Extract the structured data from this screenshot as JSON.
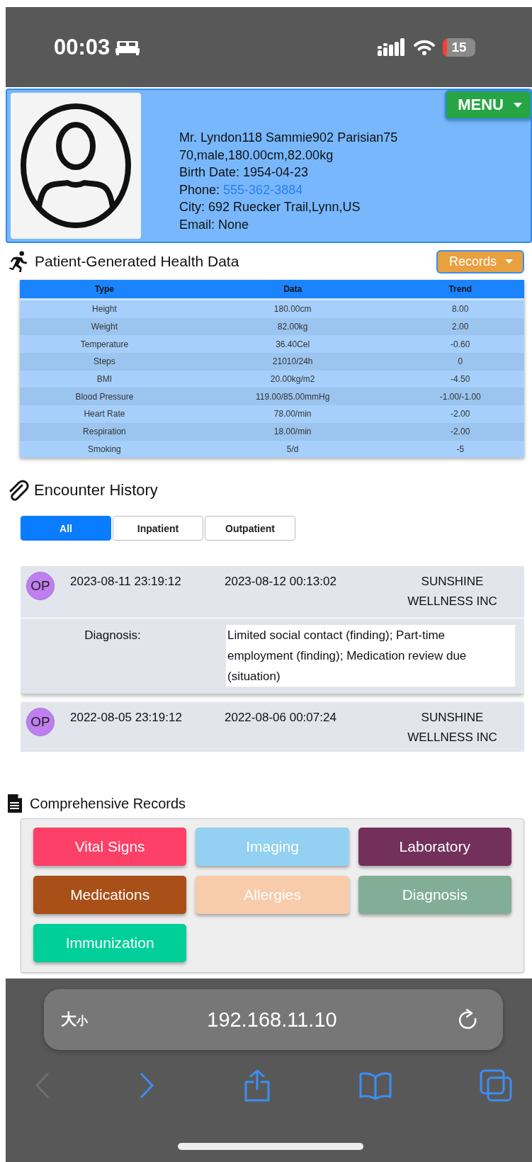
{
  "status_bar": {
    "time": "00:03",
    "battery": "15"
  },
  "patient": {
    "menu_button": "MENU",
    "name": "Mr. Lyndon118 Sammie902 Parisian75",
    "summary": "70,male,180.00cm,82.00kg",
    "details": [
      {
        "kind": "text",
        "text": "Birth Date: 1954-04-23"
      },
      {
        "kind": "link",
        "label": "Phone:",
        "value": "555-362-3884"
      },
      {
        "kind": "text",
        "text": "City: 692 Ruecker Trail,Lynn,US"
      },
      {
        "kind": "text",
        "text": "Email: None"
      }
    ]
  },
  "health_data": {
    "title": "Patient-Generated Health Data",
    "records_button": "Records",
    "table": {
      "columns": [
        "Type",
        "Data",
        "Trend"
      ],
      "rows": [
        [
          "Height",
          "180.00cm",
          "8.00"
        ],
        [
          "Weight",
          "82.00kg",
          "2.00"
        ],
        [
          "Temperature",
          "36.40Cel",
          "-0.60"
        ],
        [
          "Steps",
          "21010/24h",
          "0"
        ],
        [
          "BMI",
          "20.00kg/m2",
          "-4.50"
        ],
        [
          "Blood Pressure",
          "119.00/85.00mmHg",
          "-1.00/-1.00"
        ],
        [
          "Heart Rate",
          "78.00/min",
          "-2.00"
        ],
        [
          "Respiration",
          "18.00/min",
          "-2.00"
        ],
        [
          "Smoking",
          "5/d",
          "-5"
        ]
      ]
    }
  },
  "encounters": {
    "title": "Encounter History",
    "tabs": [
      {
        "label": "All",
        "selected": true
      },
      {
        "label": "Inpatient",
        "selected": false
      },
      {
        "label": "Outpatient",
        "selected": false
      }
    ],
    "items": [
      {
        "badge": "OP",
        "start": "2023-08-11 23:19:12",
        "end": "2023-08-12 00:13:02",
        "organization": "SUNSHINE WELLNESS INC",
        "diagnosis_label": "Diagnosis:",
        "diagnosis": "Limited social contact (finding); Part-time employment (finding); Medication review due (situation)"
      },
      {
        "badge": "OP",
        "start": "2022-08-05 23:19:12",
        "end": "2022-08-06 00:07:24",
        "organization": "SUNSHINE WELLNESS INC"
      }
    ]
  },
  "records": {
    "title": "Comprehensive Records",
    "buttons": [
      {
        "label": "Vital Signs",
        "color": "#fc4067"
      },
      {
        "label": "Imaging",
        "color": "#93d0f1"
      },
      {
        "label": "Laboratory",
        "color": "#72305b"
      },
      {
        "label": "Medications",
        "color": "#a94f18"
      },
      {
        "label": "Allergies",
        "color": "#f8cbab"
      },
      {
        "label": "Diagnosis",
        "color": "#82ae98"
      },
      {
        "label": "Immunization",
        "color": "#00cf99"
      }
    ]
  },
  "browser": {
    "text_size": "大$_{小}$",
    "url": "192.168.11.10",
    "nav": [
      {
        "kind": "back",
        "disabled": true
      },
      {
        "kind": "forward",
        "disabled": false
      },
      {
        "kind": "share",
        "disabled": false
      },
      {
        "kind": "bookmarks",
        "disabled": false
      },
      {
        "kind": "tabs",
        "disabled": false
      }
    ]
  }
}
